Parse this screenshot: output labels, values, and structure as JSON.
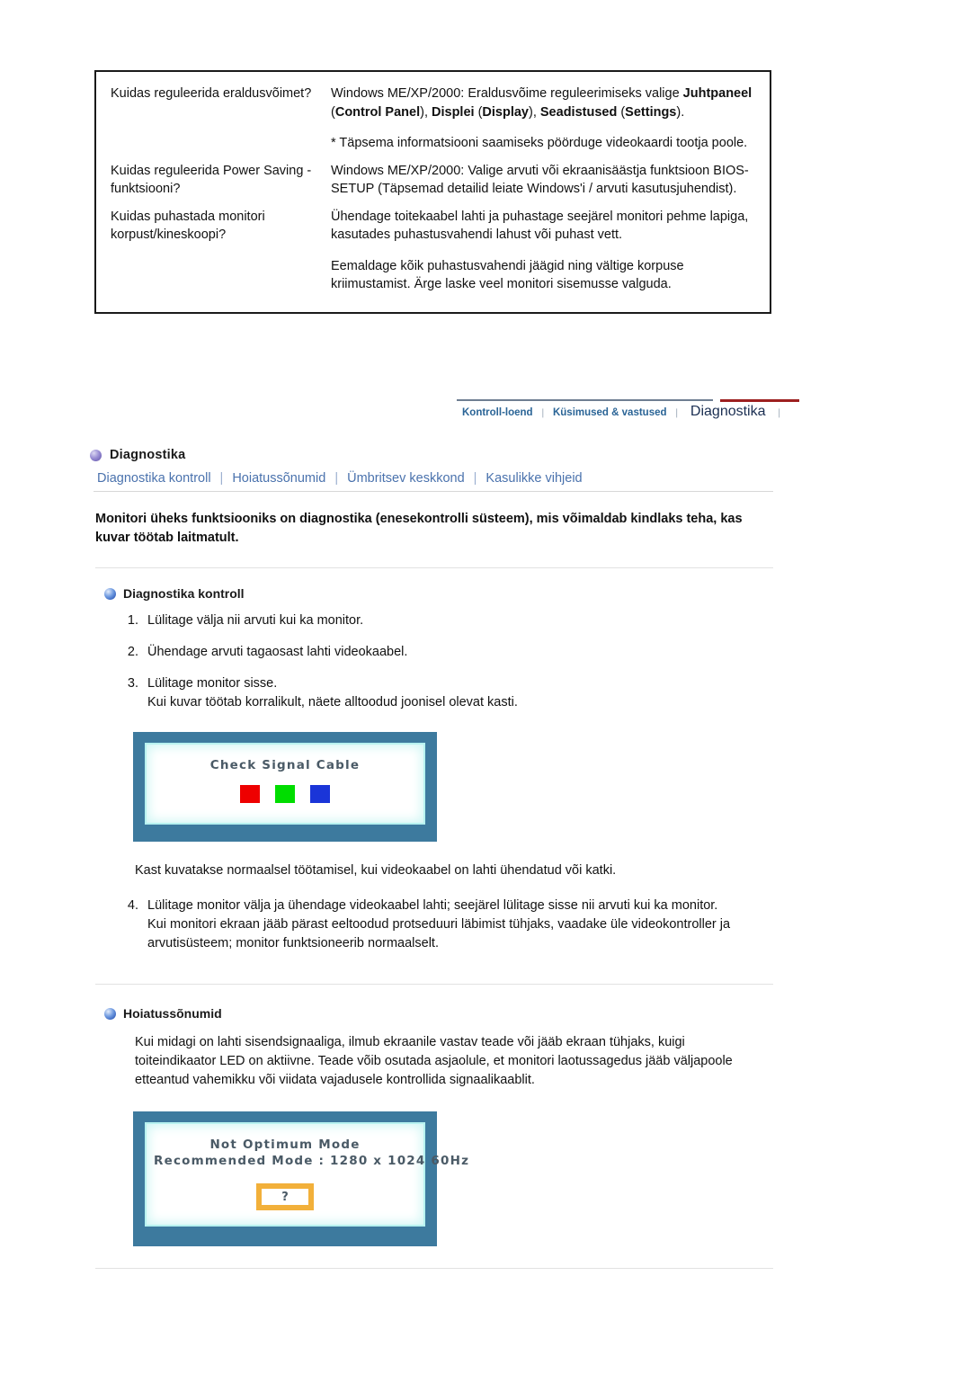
{
  "faq": {
    "rows": [
      {
        "question": "Kuidas reguleerida eraldusvõimet?",
        "answer_lead": "Windows ME/XP/2000: Eraldusvõime reguleerimiseks valige ",
        "answer_bold_1": "Juhtpaneel",
        "answer_paren_1": " (",
        "answer_bold_2": "Control Panel",
        "answer_mid_1": "), ",
        "answer_bold_3": "Displei",
        "answer_paren_2": " (",
        "answer_bold_4": "Display",
        "answer_mid_2": "), ",
        "answer_bold_5": "Seadistused",
        "answer_paren_3": " (",
        "answer_bold_6": "Settings",
        "answer_tail": ").",
        "answer_note": "* Täpsema informatsiooni saamiseks pöörduge videokaardi tootja poole."
      },
      {
        "question": "Kuidas reguleerida Power Saving -funktsiooni?",
        "answer": "Windows ME/XP/2000: Valige arvuti või ekraanisäästja funktsioon BIOS-SETUP (Täpsemad detailid leiate Windows'i / arvuti kasutusjuhendist)."
      },
      {
        "question": "Kuidas puhastada monitori korpust/kineskoopi?",
        "answer_p1": "Ühendage toitekaabel lahti ja puhastage seejärel monitori pehme lapiga, kasutades puhastusvahendi lahust või puhast vett.",
        "answer_p2": "Eemaldage kõik puhastusvahendi jäägid ning vältige korpuse kriimustamist. Ärge laske veel monitori sisemusse valguda."
      }
    ]
  },
  "tabstrip": {
    "tabs": [
      {
        "label": "Kontroll-loend",
        "active": false
      },
      {
        "label": "Küsimused & vastused",
        "active": false
      },
      {
        "label": "Diagnostika",
        "active": true
      }
    ],
    "separator": "❘",
    "active_underline_color": "#9d1f1f",
    "inactive_color": "#2a6496",
    "active_color": "#1b2f52"
  },
  "page": {
    "section_title": "Diagnostika",
    "bullet_icon": "purple-sphere-icon",
    "links": [
      "Diagnostika kontroll",
      "Hoiatussõnumid",
      "Ümbritsev keskkond",
      "Kasulikke vihjeid"
    ],
    "link_separator": "|",
    "link_color": "#4a72ad",
    "lead_paragraph": "Monitori üheks funktsiooniks on diagnostika (enesekontrolli süsteem), mis võimaldab kindlaks teha, kas kuvar töötab laitmatult."
  },
  "selfcheck": {
    "heading": "Diagnostika kontroll",
    "bullet_icon": "blue-sphere-icon",
    "steps": [
      {
        "text": "Lülitage välja nii arvuti kui ka monitor."
      },
      {
        "text": "Ühendage arvuti tagaosast lahti videokaabel."
      },
      {
        "text": "Lülitage monitor sisse.",
        "sub": "Kui kuvar töötab korralikult, näete alltoodud joonisel olevat kasti."
      }
    ],
    "osd": {
      "message": "Check Signal Cable",
      "swatches": [
        "#ee0000",
        "#00dd00",
        "#1a35d8"
      ],
      "frame_color": "#3d7a9e",
      "glow_color": "#b7f2f0"
    },
    "caption": "Kast kuvatakse normaalsel töötamisel, kui videokaabel on lahti ühendatud või katki.",
    "step4": {
      "number": "4.",
      "text": "Lülitage monitor välja ja ühendage videokaabel lahti; seejärel lülitage sisse nii arvuti kui ka monitor.",
      "sub": "Kui monitori ekraan jääb pärast eeltoodud protseduuri läbimist tühjaks, vaadake üle videokontroller ja arvutisüsteem; monitor funktsioneerib normaalselt."
    }
  },
  "warnings": {
    "heading": "Hoiatussõnumid",
    "bullet_icon": "blue-sphere-icon",
    "paragraph": "Kui midagi on lahti sisendsignaaliga, ilmub ekraanile vastav teade või jääb ekraan tühjaks, kuigi toiteindikaator LED on aktiivne. Teade võib osutada asjaolule, et monitori laotussagedus jääb väljapoole etteantud vahemikku või viidata vajadusele kontrollida signaalikaablit.",
    "osd": {
      "line1": "Not Optimum Mode",
      "line2": "Recommended Mode : 1280 x 1024  60Hz",
      "question_mark": "?",
      "frame_color": "#3d7a9e",
      "glow_color": "#b7f2f0",
      "qbox_color": "#f2b03a"
    }
  }
}
